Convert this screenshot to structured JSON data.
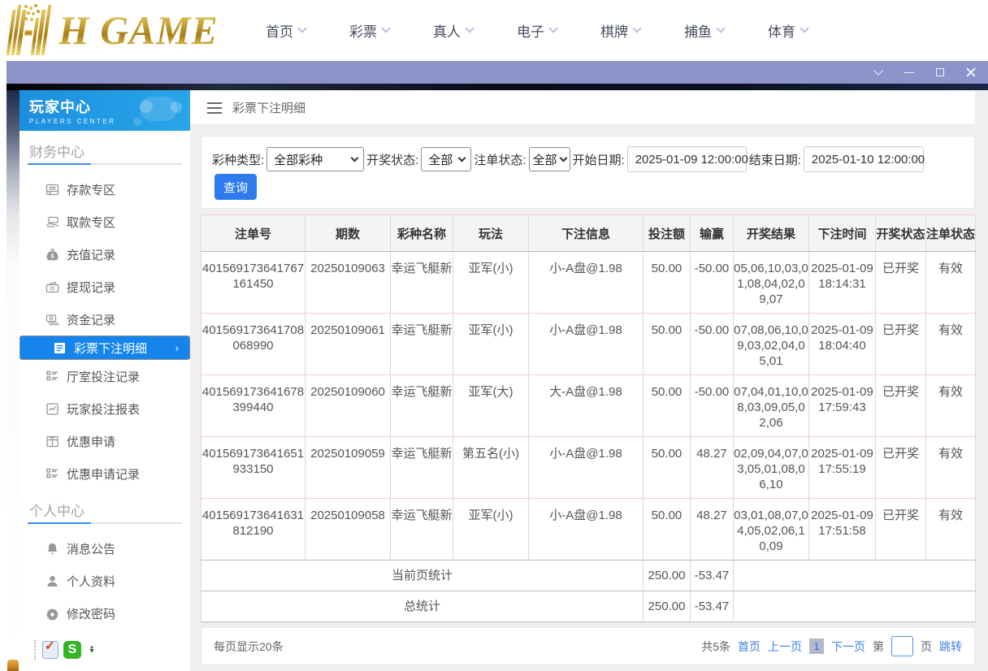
{
  "site": {
    "logo_text": "H GAME",
    "nav": [
      {
        "label": "首页"
      },
      {
        "label": "彩票"
      },
      {
        "label": "真人"
      },
      {
        "label": "电子"
      },
      {
        "label": "棋牌"
      },
      {
        "label": "捕鱼"
      },
      {
        "label": "体育"
      }
    ]
  },
  "sidebar": {
    "header": {
      "title": "玩家中心",
      "subtitle": "PLAYERS CENTER"
    },
    "sections": [
      {
        "title": "财务中心",
        "items": [
          {
            "label": "存款专区",
            "icon": "deposit-icon",
            "selected": false
          },
          {
            "label": "取款专区",
            "icon": "withdraw-icon",
            "selected": false
          },
          {
            "label": "充值记录",
            "icon": "recharge-record-icon",
            "selected": false
          },
          {
            "label": "提现记录",
            "icon": "cashout-record-icon",
            "selected": false
          },
          {
            "label": "资金记录",
            "icon": "funds-record-icon",
            "selected": false
          },
          {
            "label": "彩票下注明细",
            "icon": "lottery-bet-detail-icon",
            "selected": true
          },
          {
            "label": "厅室投注记录",
            "icon": "room-bet-record-icon",
            "selected": false
          },
          {
            "label": "玩家投注报表",
            "icon": "player-bet-report-icon",
            "selected": false
          },
          {
            "label": "优惠申请",
            "icon": "promo-apply-icon",
            "selected": false
          },
          {
            "label": "优惠申请记录",
            "icon": "promo-record-icon",
            "selected": false
          }
        ]
      },
      {
        "title": "个人中心",
        "items": [
          {
            "label": "消息公告",
            "icon": "message-icon",
            "selected": false
          },
          {
            "label": "个人资料",
            "icon": "profile-icon",
            "selected": false
          },
          {
            "label": "修改密码",
            "icon": "password-icon",
            "selected": false
          }
        ]
      }
    ]
  },
  "page": {
    "title": "彩票下注明细"
  },
  "filters": {
    "lottery_type": {
      "label": "彩种类型:",
      "value": "全部彩种"
    },
    "draw_status": {
      "label": "开奖状态:",
      "value": "全部"
    },
    "bet_status": {
      "label": "注单状态:",
      "value": "全部"
    },
    "start_date": {
      "label": "开始日期:",
      "value": "2025-01-09 12:00:00"
    },
    "end_date": {
      "label": "结束日期:",
      "value": "2025-01-10 12:00:00"
    },
    "search_label": "查询"
  },
  "table": {
    "columns": [
      "注单号",
      "期数",
      "彩种名称",
      "玩法",
      "下注信息",
      "投注额",
      "输赢",
      "开奖结果",
      "下注时间",
      "开奖状态",
      "注单状态"
    ],
    "rows": [
      [
        "401569173641767161450",
        "20250109063",
        "幸运飞艇新",
        "亚军(小)",
        "小-A盘@1.98",
        "50.00",
        "-50.00",
        "05,06,10,03,01,08,04,02,09,07",
        "2025-01-09 18:14:31",
        "已开奖",
        "有效"
      ],
      [
        "401569173641708068990",
        "20250109061",
        "幸运飞艇新",
        "亚军(小)",
        "小-A盘@1.98",
        "50.00",
        "-50.00",
        "07,08,06,10,09,03,02,04,05,01",
        "2025-01-09 18:04:40",
        "已开奖",
        "有效"
      ],
      [
        "401569173641678399440",
        "20250109060",
        "幸运飞艇新",
        "亚军(大)",
        "大-A盘@1.98",
        "50.00",
        "-50.00",
        "07,04,01,10,08,03,09,05,02,06",
        "2025-01-09 17:59:43",
        "已开奖",
        "有效"
      ],
      [
        "401569173641651933150",
        "20250109059",
        "幸运飞艇新",
        "第五名(小)",
        "小-A盘@1.98",
        "50.00",
        "48.27",
        "02,09,04,07,03,05,01,08,06,10",
        "2025-01-09 17:55:19",
        "已开奖",
        "有效"
      ],
      [
        "401569173641631812190",
        "20250109058",
        "幸运飞艇新",
        "亚军(小)",
        "小-A盘@1.98",
        "50.00",
        "48.27",
        "03,01,08,07,04,05,02,06,10,09",
        "2025-01-09 17:51:58",
        "已开奖",
        "有效"
      ]
    ],
    "summaries": [
      {
        "label": "当前页统计",
        "bet": "250.00",
        "winloss": "-53.47"
      },
      {
        "label": "总统计",
        "bet": "250.00",
        "winloss": "-53.47"
      }
    ]
  },
  "pagination": {
    "per_page": "每页显示20条",
    "total": "共5条",
    "first": "首页",
    "prev": "上一页",
    "current": "1",
    "next": "下一页",
    "jump_pre": "第",
    "jump_post": "页",
    "jump": "跳转"
  }
}
